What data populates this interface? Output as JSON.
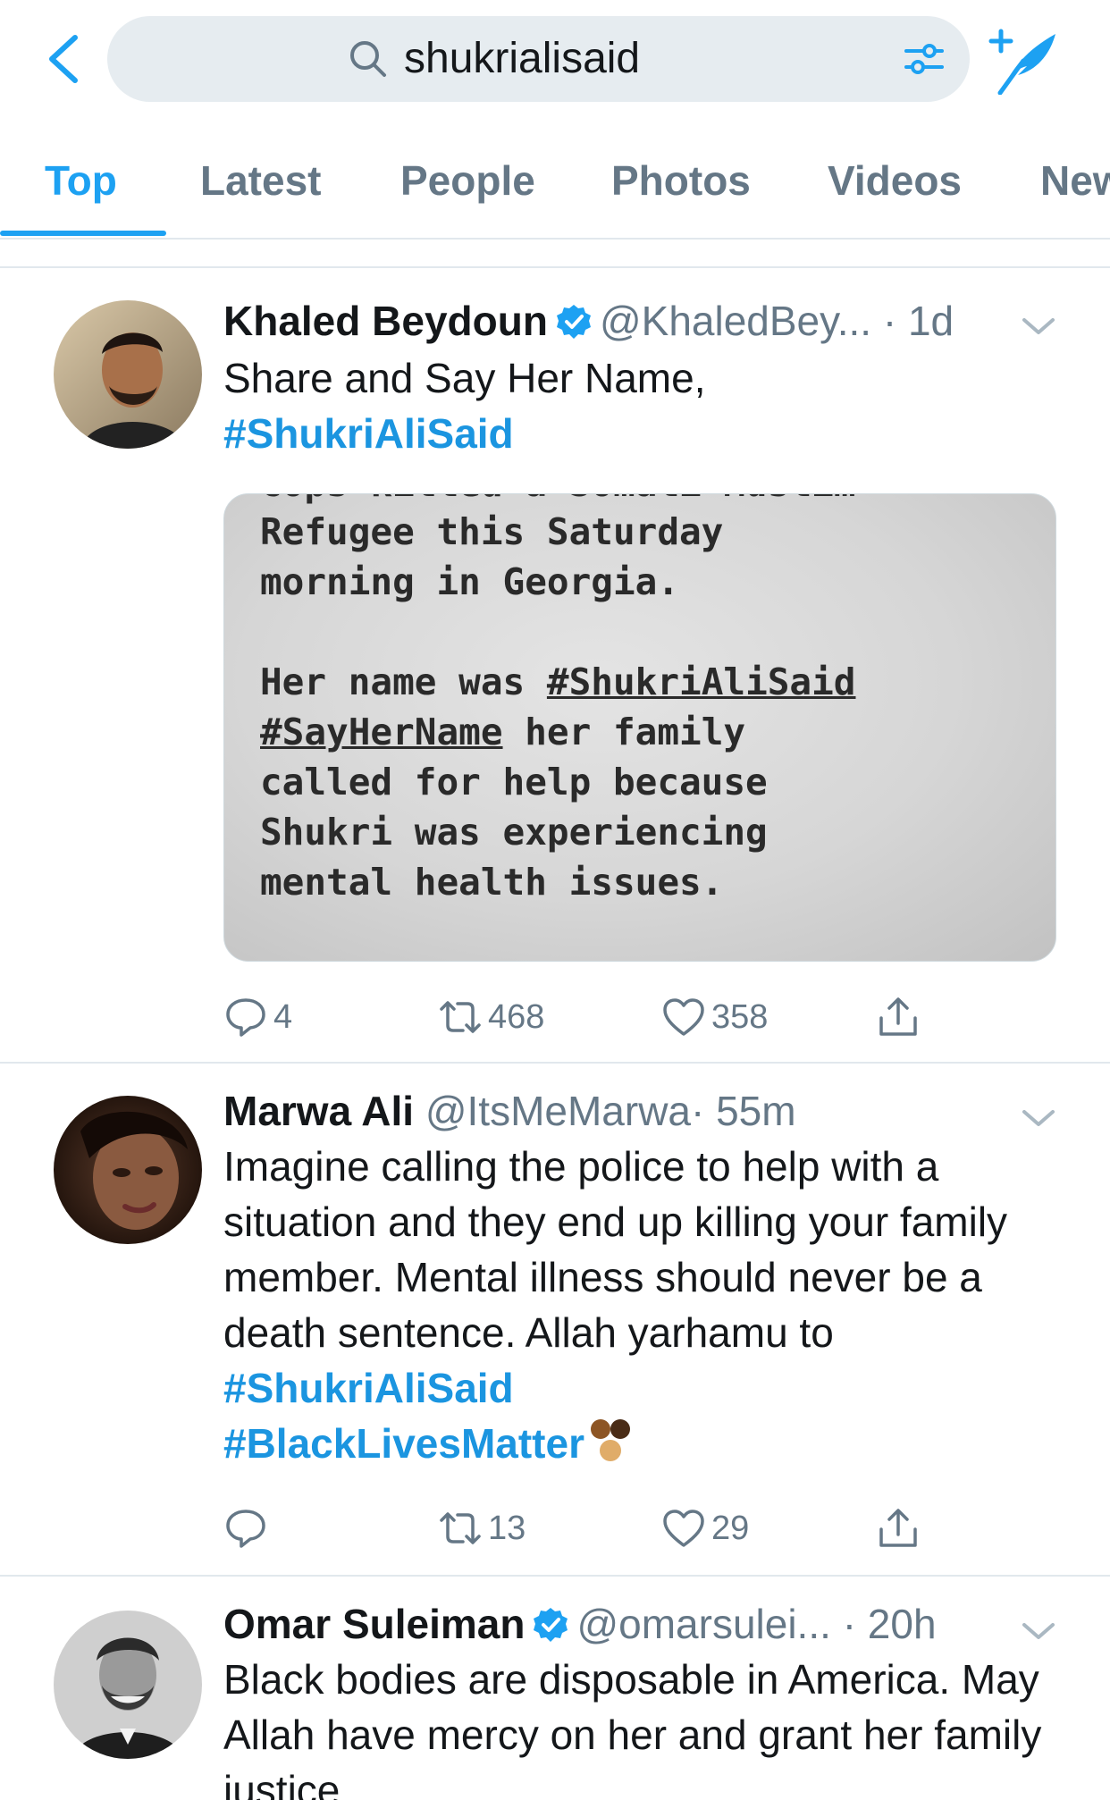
{
  "search": {
    "query": "shukrialisaid"
  },
  "tabs": [
    {
      "label": "Top",
      "active": true
    },
    {
      "label": "Latest",
      "active": false
    },
    {
      "label": "People",
      "active": false
    },
    {
      "label": "Photos",
      "active": false
    },
    {
      "label": "Videos",
      "active": false
    },
    {
      "label": "New",
      "active": false
    }
  ],
  "colors": {
    "accent": "#1da1f2",
    "hashtag": "#1b95e0",
    "muted": "#657786",
    "divider": "#e1e8ed"
  },
  "tweets": [
    {
      "name": "Khaled Beydoun",
      "verified": true,
      "handle": "@KhaledBey...",
      "time": "· 1d",
      "text_line1": "Share and Say Her Name,",
      "hashtag1": "#ShukriAliSaid",
      "media": {
        "cut_line": "cops killed a Somali Muslim",
        "line1": "Refugee this Saturday",
        "line2": "morning in Georgia.",
        "line3_prefix": "Her name was ",
        "line3_tag": "#ShukriAliSaid",
        "line4_tag": "#SayHerName",
        "line4_suffix": " her family",
        "line5": "called for help because",
        "line6": "Shukri was experiencing",
        "line7": "mental health issues."
      },
      "replies": "4",
      "retweets": "468",
      "likes": "358"
    },
    {
      "name": "Marwa Ali",
      "verified": false,
      "handle": "@ItsMeMarwa",
      "time": "· 55m",
      "text_main": "Imagine calling the police to help with a situation and they end up killing your family member. Mental illness should never be a death sentence. Allah yarhamu to ",
      "hashtag1": "#ShukriAliSaid",
      "hashtag2": "#BlackLivesMatter",
      "replies": "",
      "retweets": "13",
      "likes": "29"
    },
    {
      "name": "Omar Suleiman",
      "verified": true,
      "handle": "@omarsulei...",
      "time": "· 20h",
      "text_main": "Black bodies are disposable in America. May Allah have mercy on her and grant her family justice."
    }
  ]
}
